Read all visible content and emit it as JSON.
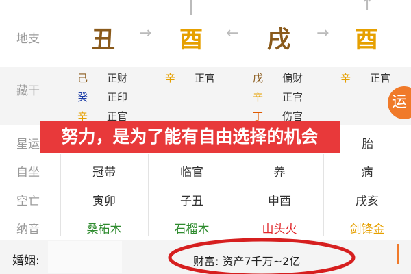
{
  "rows": {
    "dizhi": "地支",
    "canggan": "藏干",
    "xingyun": "星运",
    "zizuo": "自坐",
    "kongwang": "空亡",
    "nayin": "纳音"
  },
  "dizhi": [
    "丑",
    "酉",
    "戌",
    "酉"
  ],
  "arrows": [
    "→",
    "←",
    "→"
  ],
  "canggan": {
    "col1": [
      {
        "gan": "己",
        "shen": "正财"
      },
      {
        "gan": "癸",
        "shen": "正印"
      },
      {
        "gan": "辛",
        "shen": "正官"
      }
    ],
    "col2": [
      {
        "gan": "辛",
        "shen": "正官"
      }
    ],
    "col3": [
      {
        "gan": "戊",
        "shen": "偏财"
      },
      {
        "gan": "辛",
        "shen": "正官"
      },
      {
        "gan": "丁",
        "shen": "伤官"
      }
    ],
    "col4": [
      {
        "gan": "辛",
        "shen": "正官"
      }
    ]
  },
  "xingyun_col4": "胎",
  "zizuo": [
    "冠带",
    "临官",
    "养",
    "病"
  ],
  "kongwang": [
    "寅卯",
    "子丑",
    "申酉",
    "戌亥"
  ],
  "nayin": [
    {
      "text": "桑柘木",
      "color": "#2e8b2e"
    },
    {
      "text": "石榴木",
      "color": "#2e8b2e"
    },
    {
      "text": "山头火",
      "color": "#e0262a"
    },
    {
      "text": "剑锋金",
      "color": "#e6a000"
    }
  ],
  "banner": "努力，是为了能有自由选择的机会",
  "yun_button": "运",
  "bottom": {
    "marriage_label": "婚姻:",
    "wealth": "财富: 资产7千万~2亿"
  },
  "colors": {
    "banner_bg": "#e8393a",
    "yun_bg": "#f07a2a",
    "oval": "#d61f1f"
  }
}
